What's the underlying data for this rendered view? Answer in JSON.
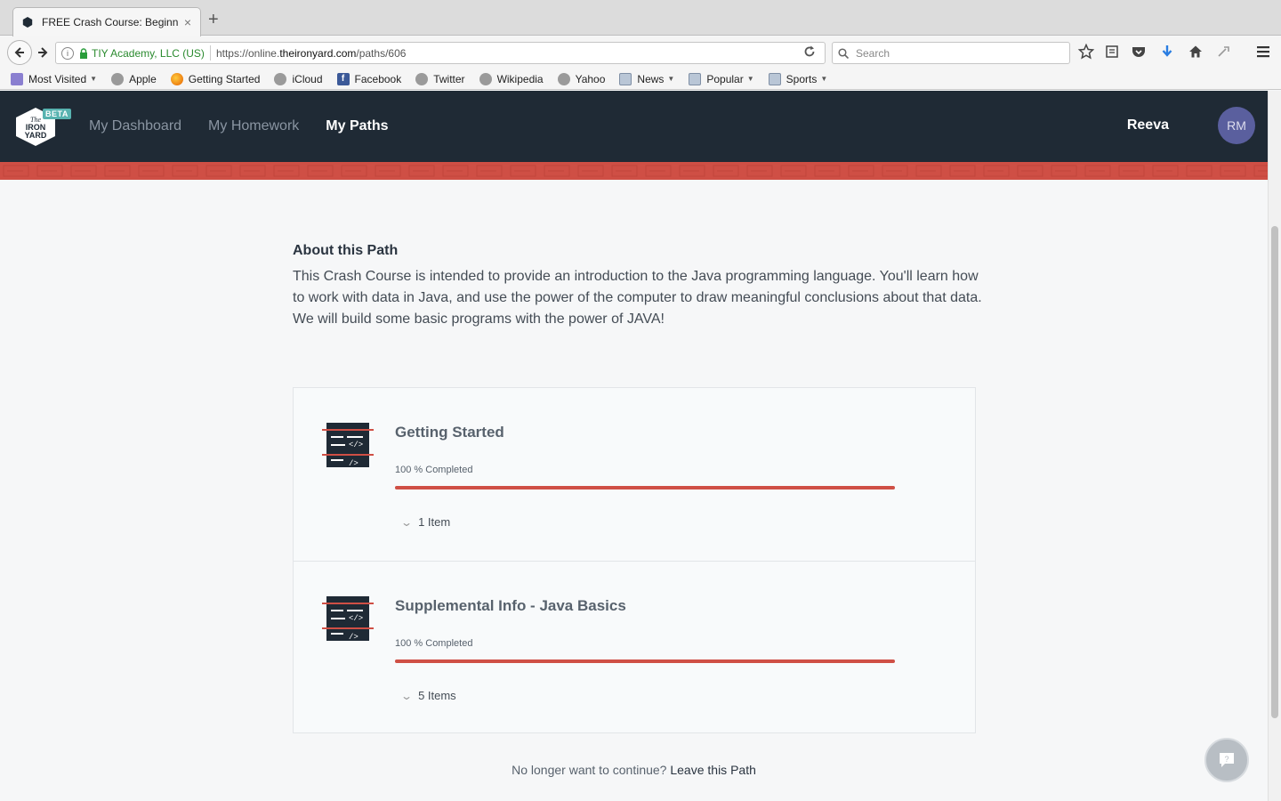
{
  "browser": {
    "tab_title": "FREE Crash Course: Beginn...",
    "tab_close": "×",
    "new_tab": "+",
    "site_identity": "TIY Academy, LLC (US)",
    "url_prefix": "https://online.",
    "url_domain": "theironyard.com",
    "url_path": "/paths/606",
    "search_placeholder": "Search"
  },
  "bookmarks": [
    {
      "label": "Most Visited",
      "icon": "most-visited-icon",
      "dropdown": true
    },
    {
      "label": "Apple",
      "icon": "globe-icon"
    },
    {
      "label": "Getting Started",
      "icon": "firefox-icon"
    },
    {
      "label": "iCloud",
      "icon": "globe-icon"
    },
    {
      "label": "Facebook",
      "icon": "facebook-icon"
    },
    {
      "label": "Twitter",
      "icon": "globe-icon"
    },
    {
      "label": "Wikipedia",
      "icon": "globe-icon"
    },
    {
      "label": "Yahoo",
      "icon": "globe-icon"
    },
    {
      "label": "News",
      "icon": "folder-icon",
      "dropdown": true
    },
    {
      "label": "Popular",
      "icon": "folder-icon",
      "dropdown": true
    },
    {
      "label": "Sports",
      "icon": "folder-icon",
      "dropdown": true
    }
  ],
  "app": {
    "logo_badge": "BETA",
    "nav": [
      "My Dashboard",
      "My Homework",
      "My Paths"
    ],
    "active_nav": "My Paths",
    "user_name": "Reeva",
    "user_initials": "RM",
    "colors": {
      "header": "#1f2a35",
      "accent": "#cf4f45",
      "avatar": "#5a5f9e"
    }
  },
  "about": {
    "heading": "About this Path",
    "body": "This Crash Course is intended to provide an introduction to the Java programming language. You'll learn how to work with data in Java, and use the power of the computer to draw meaningful conclusions about that data. We will build some basic programs with the power of JAVA!"
  },
  "steps": [
    {
      "title": "Getting Started",
      "progress_label": "100 % Completed",
      "progress": 100,
      "items_label": "1 Item"
    },
    {
      "title": "Supplemental Info - Java Basics",
      "progress_label": "100 % Completed",
      "progress": 100,
      "items_label": "5 Items"
    }
  ],
  "footer": {
    "prompt": "No longer want to continue?",
    "leave_link": "Leave this Path"
  }
}
